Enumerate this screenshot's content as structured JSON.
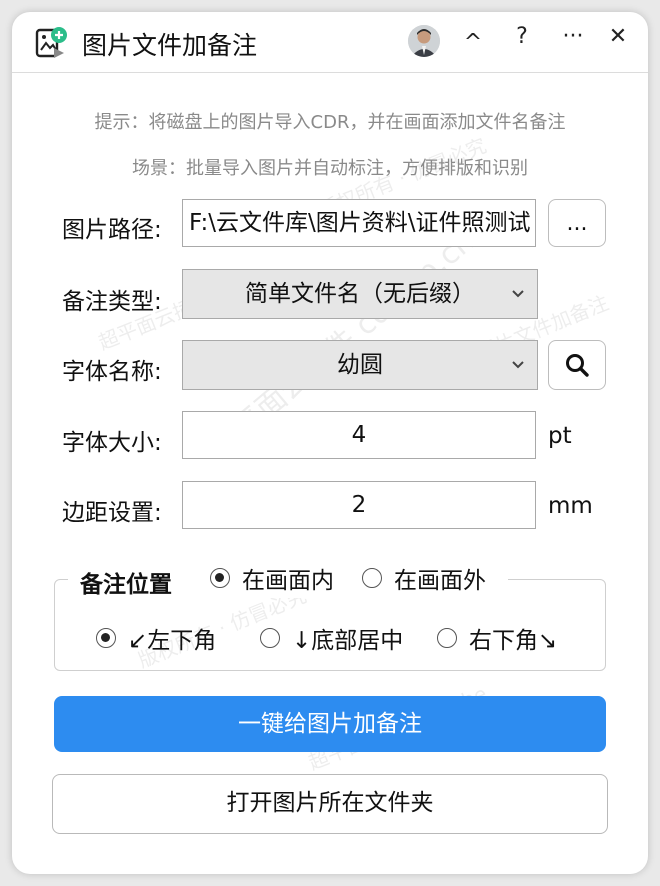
{
  "window": {
    "title": "图片文件加备注",
    "controls": {
      "collapse": "^",
      "help": "?",
      "more": "···",
      "close": "✕"
    }
  },
  "hints": [
    "提示：将磁盘上的图片导入CDR，并在画面添加文件名备注",
    "场景：批量导入图片并自动标注，方便排版和识别"
  ],
  "form": {
    "path": {
      "label": "图片路径:",
      "value": "F:\\云文件库\\图片资料\\证件照测试",
      "browse_label": "..."
    },
    "note_type": {
      "label": "备注类型:",
      "selected": "简单文件名（无后缀）"
    },
    "font_name": {
      "label": "字体名称:",
      "selected": "幼圆"
    },
    "font_size": {
      "label": "字体大小:",
      "value": "4",
      "unit": "pt"
    },
    "margin": {
      "label": "边距设置:",
      "value": "2",
      "unit": "mm"
    }
  },
  "position_group": {
    "title": "备注位置",
    "placement": [
      {
        "label": "在画面内",
        "checked": true
      },
      {
        "label": "在画面外",
        "checked": false
      }
    ],
    "anchor": [
      {
        "label": "↙左下角",
        "checked": true
      },
      {
        "label": "↓底部居中",
        "checked": false
      },
      {
        "label": "右下角↘",
        "checked": false
      }
    ]
  },
  "actions": {
    "primary": "一键给图片加备注",
    "secondary": "打开图片所在文件夹"
  },
  "watermark": {
    "text": "超平面云插件 cdrccp.cn",
    "lines": [
      "超平面云插件 · Zebe",
      "版权所有 · 仿冒必究",
      "图片文件加备注"
    ]
  },
  "colors": {
    "accent": "#2d8cf0",
    "icon_badge": "#2bbd8a"
  }
}
